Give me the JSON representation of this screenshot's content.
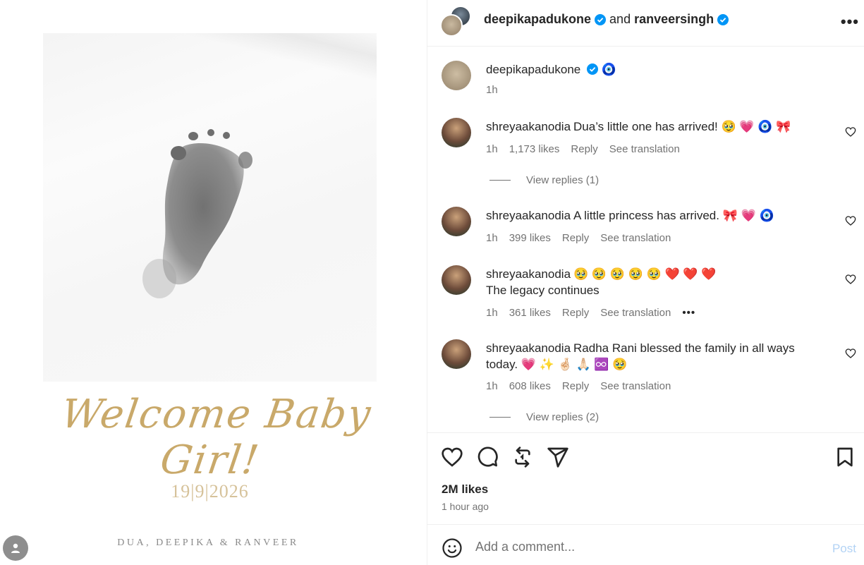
{
  "media": {
    "welcome_text": "Welcome Baby Girl!",
    "date_text": "19|9|2026",
    "names_text": "DUA, DEEPIKA & RANVEER"
  },
  "header": {
    "user1": "deepikapadukone",
    "joiner": "and",
    "user2": "ranveersingh",
    "more_icon": "more-horizontal-icon"
  },
  "caption": {
    "username": "deepikapadukone",
    "emoji": "🧿",
    "time": "1h"
  },
  "comments": [
    {
      "username": "shreyaakanodia",
      "text": "Dua’s little one has arrived! 🥹 💗 🧿 🎀",
      "time": "1h",
      "likes": "1,173 likes",
      "reply": "Reply",
      "translation": "See translation",
      "view_replies": "View replies (1)"
    },
    {
      "username": "shreyaakanodia",
      "text": "A little princess has arrived. 🎀 💗 🧿",
      "time": "1h",
      "likes": "399 likes",
      "reply": "Reply",
      "translation": "See translation"
    },
    {
      "username": "shreyaakanodia",
      "text": "🥹 🥹 🥹 🥹 🥹 ❤️ ❤️ ❤️",
      "text2": "The legacy continues",
      "time": "1h",
      "likes": "361 likes",
      "reply": "Reply",
      "translation": "See translation",
      "more": "•••"
    },
    {
      "username": "shreyaakanodia",
      "text": "Radha Rani blessed the family in all ways",
      "text2": "today. 💗 ✨ 🤞🏻 🙏🏻 ♾️ 🥹",
      "time": "1h",
      "likes": "608 likes",
      "reply": "Reply",
      "translation": "See translation",
      "view_replies": "View replies (2)"
    }
  ],
  "footer": {
    "likes_total": "2M likes",
    "time_ago": "1 hour ago"
  },
  "composer": {
    "placeholder": "Add a comment...",
    "post_label": "Post"
  },
  "colors": {
    "verified": "#0095f6",
    "post_disabled": "#b3d3f5",
    "gold": "#c9a96a"
  }
}
